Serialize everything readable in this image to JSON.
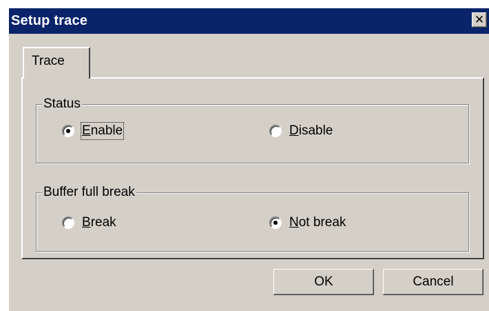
{
  "window": {
    "title": "Setup trace",
    "close_glyph": "✕"
  },
  "tabs": [
    {
      "label": "Trace",
      "active": true
    }
  ],
  "status_group": {
    "legend": "Status",
    "options": [
      {
        "mnemonic": "E",
        "rest": "nable",
        "checked": true
      },
      {
        "mnemonic": "D",
        "rest": "isable",
        "checked": false
      }
    ]
  },
  "buffer_group": {
    "legend": "Buffer full break",
    "options": [
      {
        "mnemonic": "B",
        "rest": "reak",
        "checked": false
      },
      {
        "mnemonic": "N",
        "rest": "ot break",
        "checked": true
      }
    ]
  },
  "buttons": {
    "ok": "OK",
    "cancel": "Cancel"
  },
  "colors": {
    "titlebar": "#0a246a",
    "face": "#d4d0c8"
  }
}
